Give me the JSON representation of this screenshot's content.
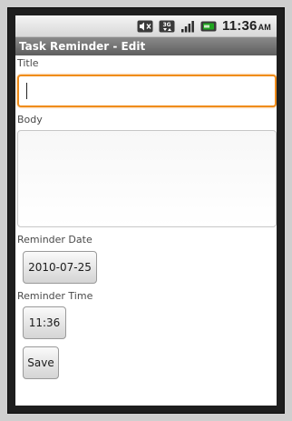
{
  "status_bar": {
    "icons": [
      "mute-icon",
      "3g-icon",
      "signal-icon",
      "battery-icon"
    ],
    "time": "11:36",
    "ampm": "AM"
  },
  "title_bar": {
    "title": "Task Reminder - Edit"
  },
  "form": {
    "title_label": "Title",
    "title_value": "",
    "body_label": "Body",
    "body_value": "",
    "reminder_date_label": "Reminder Date",
    "reminder_date_value": "2010-07-25",
    "reminder_time_label": "Reminder Time",
    "reminder_time_value": "11:36",
    "save_label": "Save"
  },
  "colors": {
    "focus_border": "#f08c1a",
    "title_bar": "#6e6e6e",
    "battery": "#1fa51f"
  }
}
